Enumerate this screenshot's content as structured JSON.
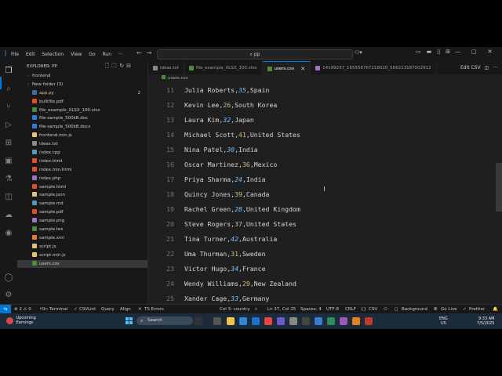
{
  "titlebar": {
    "menu": [
      "File",
      "Edit",
      "Selection",
      "View",
      "Go",
      "Run"
    ],
    "more": "···",
    "search": "pp"
  },
  "explorer": {
    "header": "EXPLORER: PP",
    "items": [
      {
        "label": "frontend",
        "kind": "folder",
        "chevron": "›",
        "color": "#9da5b4"
      },
      {
        "label": "New folder (3)",
        "kind": "folder",
        "chevron": "›",
        "color": "#9da5b4"
      },
      {
        "label": "app.py",
        "kind": "file",
        "color": "#3572A5",
        "badge": "2"
      },
      {
        "label": "bulkfile.pdf",
        "kind": "file",
        "color": "#e44d26"
      },
      {
        "label": "file_example_XLSX_100.xlsx",
        "kind": "file",
        "color": "#4d8a3e"
      },
      {
        "label": "file-sample_500kB.doc",
        "kind": "file",
        "color": "#2b7cd3"
      },
      {
        "label": "file-sample_500kB.docx",
        "kind": "file",
        "color": "#2b7cd3"
      },
      {
        "label": "frontend.min.js",
        "kind": "file",
        "color": "#e5c07b"
      },
      {
        "label": "ideas.txt",
        "kind": "file",
        "color": "#8a8a8a"
      },
      {
        "label": "index.cpp",
        "kind": "file",
        "color": "#519aba"
      },
      {
        "label": "index.html",
        "kind": "file",
        "color": "#e44d26"
      },
      {
        "label": "index.min.html",
        "kind": "file",
        "color": "#e44d26"
      },
      {
        "label": "index.php",
        "kind": "file",
        "color": "#a074c4"
      },
      {
        "label": "sample.html",
        "kind": "file",
        "color": "#e44d26"
      },
      {
        "label": "sample.json",
        "kind": "file",
        "color": "#e5c07b"
      },
      {
        "label": "sample.md",
        "kind": "file",
        "color": "#519aba"
      },
      {
        "label": "sample.pdf",
        "kind": "file",
        "color": "#e44d26"
      },
      {
        "label": "sample.png",
        "kind": "file",
        "color": "#a074c4"
      },
      {
        "label": "sample.tex",
        "kind": "file",
        "color": "#4d8a3e"
      },
      {
        "label": "sample.xml",
        "kind": "file",
        "color": "#e37933"
      },
      {
        "label": "script.js",
        "kind": "file",
        "color": "#e5c07b"
      },
      {
        "label": "script.min.js",
        "kind": "file",
        "color": "#e5c07b"
      },
      {
        "label": "users.csv",
        "kind": "file",
        "color": "#4d8a3e",
        "selected": true
      }
    ]
  },
  "tabs": [
    {
      "label": "ideas.txt",
      "color": "#8a8a8a"
    },
    {
      "label": "file_example_XLSX_100.xlsx",
      "color": "#4d8a3e"
    },
    {
      "label": "users.csv",
      "color": "#4d8a3e",
      "active": true
    },
    {
      "label": "14199237_165556767218020_566213187002912",
      "color": "#a074c4"
    }
  ],
  "tab_actions": {
    "csv_label": "Edit CSV",
    "more": "···"
  },
  "breadcrumb": "users.csv",
  "editor": {
    "lines": [
      {
        "n": "11",
        "name": "Julia Roberts",
        "age": "35",
        "country": "Spain"
      },
      {
        "n": "12",
        "name": "Kevin Lee",
        "age": "26",
        "country": "South Korea"
      },
      {
        "n": "13",
        "name": "Laura Kim",
        "age": "32",
        "country": "Japan"
      },
      {
        "n": "14",
        "name": "Michael Scott",
        "age": "41",
        "country": "United States"
      },
      {
        "n": "15",
        "name": "Nina Patel",
        "age": "30",
        "country": "India"
      },
      {
        "n": "16",
        "name": "Oscar Martinez",
        "age": "36",
        "country": "Mexico"
      },
      {
        "n": "17",
        "name": "Priya Sharma",
        "age": "24",
        "country": "India"
      },
      {
        "n": "18",
        "name": "Quincy Jones",
        "age": "39",
        "country": "Canada"
      },
      {
        "n": "19",
        "name": "Rachel Green",
        "age": "28",
        "country": "United Kingdom"
      },
      {
        "n": "20",
        "name": "Steve Rogers",
        "age": "37",
        "country": "United States"
      },
      {
        "n": "21",
        "name": "Tina Turner",
        "age": "42",
        "country": "Australia"
      },
      {
        "n": "22",
        "name": "Uma Thurman",
        "age": "31",
        "country": "Sweden"
      },
      {
        "n": "23",
        "name": "Victor Hugo",
        "age": "34",
        "country": "France"
      },
      {
        "n": "24",
        "name": "Wendy Williams",
        "age": "29",
        "country": "New Zealand"
      },
      {
        "n": "25",
        "name": "Xander Cage",
        "age": "33",
        "country": "Germany"
      }
    ]
  },
  "statusbar": {
    "problems": "⊗ 2 ⚠ 0",
    "ports": "⚡0",
    "terminal": "Terminal",
    "csvlint": "CSVLint",
    "query": "Query",
    "align": "Align",
    "ts_errors": "TS Errors",
    "column": "Col 3: country",
    "position": "Ln 37, Col 25",
    "spaces": "Spaces: 4",
    "encoding": "UTF-8",
    "eol": "CRLF",
    "language": "CSV",
    "background": "Background",
    "golive": "Go Live",
    "prettier": "Prettier"
  },
  "taskbar": {
    "weather_line1": "Upcoming",
    "weather_line2": "Earnings",
    "search": "Search",
    "lang1": "ENG",
    "lang2": "US",
    "time": "9:33 AM",
    "date": "7/5/2025"
  },
  "colors": {
    "accent": "#0078d4",
    "background": "#1f1f1f",
    "sidebar": "#181818"
  }
}
